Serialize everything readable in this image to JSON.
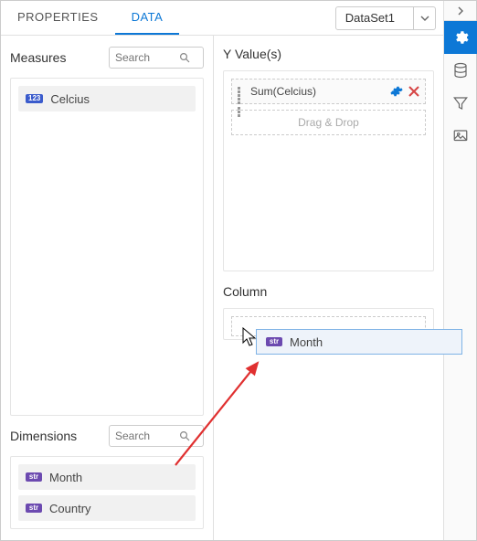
{
  "tabs": {
    "properties": "PROPERTIES",
    "data": "DATA"
  },
  "dataset": {
    "selected": "DataSet1"
  },
  "left": {
    "measures_title": "Measures",
    "dimensions_title": "Dimensions",
    "search_placeholder": "Search",
    "measures": {
      "badge0": "123",
      "item0": "Celcius"
    },
    "dimensions": {
      "badge": "str",
      "item0": "Month",
      "item1": "Country"
    }
  },
  "right": {
    "yvalues_title": "Y Value(s)",
    "column_title": "Column",
    "sum_label": "Sum(Celcius)",
    "drop_hint": "Drag & Drop"
  },
  "ghost": {
    "badge": "str",
    "label": "Month"
  }
}
